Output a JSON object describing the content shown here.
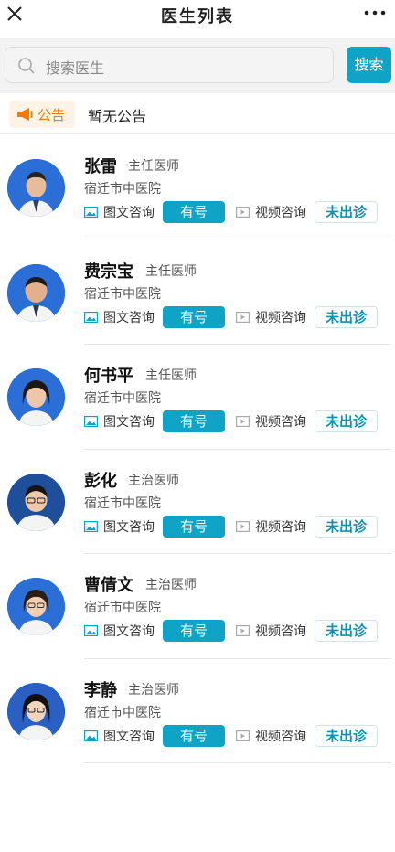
{
  "header": {
    "title": "医生列表"
  },
  "search": {
    "placeholder": "搜索医生",
    "button_label": "搜索"
  },
  "notice": {
    "tag_label": "公告",
    "text": "暂无公告"
  },
  "labels": {
    "picture_consult": "图文咨询",
    "has_slot": "有号",
    "video_consult": "视频咨询",
    "no_clinic": "未出诊"
  },
  "doctors": [
    {
      "name": "张雷",
      "title": "主任医师",
      "hospital": "宿迁市中医院"
    },
    {
      "name": "费宗宝",
      "title": "主任医师",
      "hospital": "宿迁市中医院"
    },
    {
      "name": "何书平",
      "title": "主任医师",
      "hospital": "宿迁市中医院"
    },
    {
      "name": "彭化",
      "title": "主治医师",
      "hospital": "宿迁市中医院"
    },
    {
      "name": "曹倩文",
      "title": "主治医师",
      "hospital": "宿迁市中医院"
    },
    {
      "name": "李静",
      "title": "主治医师",
      "hospital": "宿迁市中医院"
    }
  ],
  "colors": {
    "accent": "#0fa4c6",
    "notice_orange": "#f07b00",
    "avatar_bg": "#2b6fd6"
  }
}
